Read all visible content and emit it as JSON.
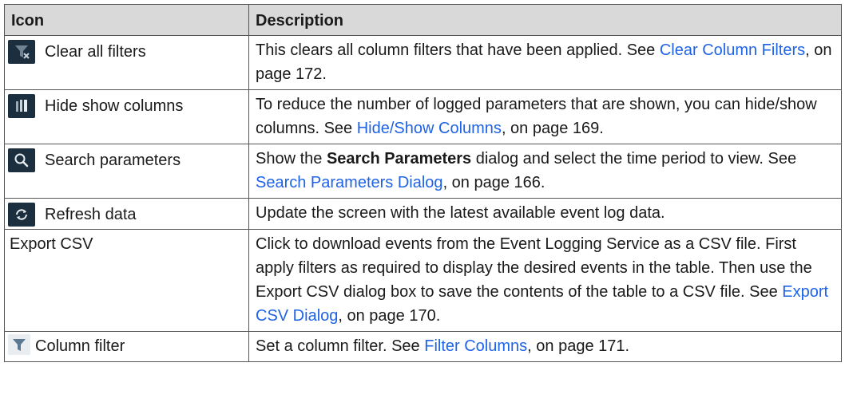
{
  "table": {
    "header": {
      "icon": "Icon",
      "description": "Description"
    },
    "rows": [
      {
        "icon_name": "clear-filters-icon",
        "label": "Clear all filters",
        "desc_pre": "This clears all column filters that have been applied. See ",
        "link": "Clear Column Filters",
        "desc_post": ", on page 172."
      },
      {
        "icon_name": "columns-icon",
        "label": "Hide show columns",
        "desc_pre": "To reduce the number of logged parameters that are shown, you can hide/show columns. See ",
        "link": "Hide/Show Columns",
        "desc_post": ", on page 169."
      },
      {
        "icon_name": "search-icon",
        "label": "Search parameters",
        "desc_pre": "Show the ",
        "desc_bold": "Search Parameters",
        "desc_mid": " dialog and select the time period to view. See ",
        "link": "Search Parameters Dialog",
        "desc_post": ", on page 166."
      },
      {
        "icon_name": "refresh-icon",
        "label": "Refresh data",
        "desc": "Update the screen with the latest available event log data."
      },
      {
        "label": "Export CSV",
        "desc_pre": "Click to download events from the Event Logging Service as a CSV file. First apply filters as required to display the desired events in the table. Then use the Export CSV dialog box to save the contents of the table to a CSV file. See ",
        "link": "Export CSV Dialog",
        "desc_post": ", on page 170."
      },
      {
        "icon_name": "filter-icon",
        "label": "Column filter",
        "desc_pre": "Set a column filter. See ",
        "link": "Filter Columns",
        "desc_post": ", on page 171."
      }
    ]
  },
  "colors": {
    "icon_dark": "#1c2f3e",
    "icon_light": "#e9edf1",
    "link": "#1f63e6",
    "header_bg": "#d9d9d9"
  }
}
